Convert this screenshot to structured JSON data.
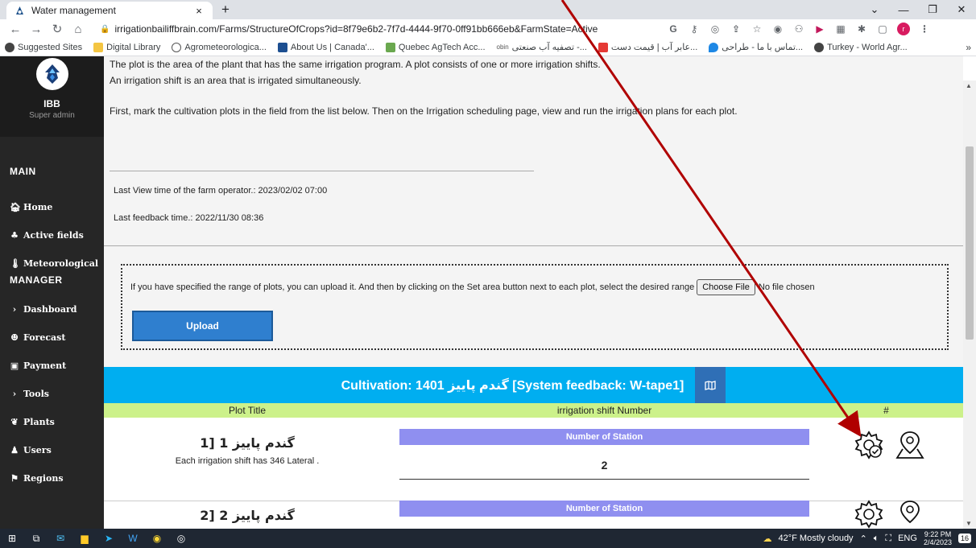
{
  "browser": {
    "tab_title": "Water management",
    "tab_close": "×",
    "new_tab": "+",
    "url": "irrigationbailiffbrain.com/Farms/StructureOfCrops?id=8f79e6b2-7f7d-4444-9f70-0ff91bb666eb&FarmState=Active",
    "bookmarks": [
      "Suggested Sites",
      "Digital Library",
      "Agrometeorologica...",
      "About Us | Canada'...",
      "Quebec AgTech Acc...",
      "تصفیه آب صنعتی -...",
      "عابر آب | قیمت دست...",
      "تماس با ما - طراحی...",
      "Turkey - World Agr..."
    ],
    "bookmarks_more": "»",
    "profile_letter": "r"
  },
  "sidebar": {
    "brand_name": "IBB",
    "brand_role": "Super admin",
    "section_main": "MAIN",
    "section_manager": "MANAGER",
    "main_items": [
      {
        "label": "Home",
        "icon": "home-icon"
      },
      {
        "label": "Active fields",
        "icon": "tree-icon"
      },
      {
        "label": "Meteorological",
        "icon": "thermometer-icon"
      }
    ],
    "manager_items": [
      {
        "label": "Dashboard",
        "icon": "chevron-right-icon"
      },
      {
        "label": "Forecast",
        "icon": "people-icon"
      },
      {
        "label": "Payment",
        "icon": "card-icon"
      },
      {
        "label": "Tools",
        "icon": "chevron-right-icon"
      },
      {
        "label": "Plants",
        "icon": "leaf-icon"
      },
      {
        "label": "Users",
        "icon": "user-icon"
      },
      {
        "label": "Regions",
        "icon": "flag-icon"
      }
    ]
  },
  "main": {
    "intro_line1": "The plot is the area of the plant that has the same irrigation program. A plot consists of one or more irrigation shifts.",
    "intro_line2": "An irrigation shift is an area that is irrigated simultaneously.",
    "intro_line3": "First, mark the cultivation plots in the field from the list below. Then on the Irrigation scheduling page, view and run the irrigation plans for each plot.",
    "last_view": "Last View time of the farm operator.: 2023/02/02 07:00",
    "last_feedback": "Last feedback time.: 2022/11/30 08:36",
    "upload_text": "If you have specified the range of plots, you can upload it. And then by clicking on the Set area button next to each plot, select the desired range",
    "choose_file": "Choose File",
    "no_file": "No file chosen",
    "upload_button": "Upload",
    "cultivation_title": "Cultivation: 1401 گندم پاییز [System feedback: W-tape1]",
    "table_headers": {
      "plot_title": "Plot Title",
      "shift_number": "irrigation shift Number",
      "hash": "#"
    },
    "rows": [
      {
        "plot_name": "گندم پاییز 1 [1",
        "note": "Each irrigation shift has 346 Lateral .",
        "station_header": "Number of Station",
        "station_value": "2"
      },
      {
        "plot_name": "گندم پاییز 2 [2",
        "note": "",
        "station_header": "Number of Station",
        "station_value": ""
      }
    ]
  },
  "taskbar": {
    "weather": "42°F  Mostly cloudy",
    "lang": "ENG",
    "time": "9:22 PM",
    "date": "2/4/2023",
    "notif_count": "16"
  },
  "colors": {
    "accent_blue": "#00aef0",
    "upload_blue": "#2f7fcf",
    "header_green": "#ccf18a",
    "station_purple": "#8f8ff0",
    "arrow_red": "#b00000"
  }
}
